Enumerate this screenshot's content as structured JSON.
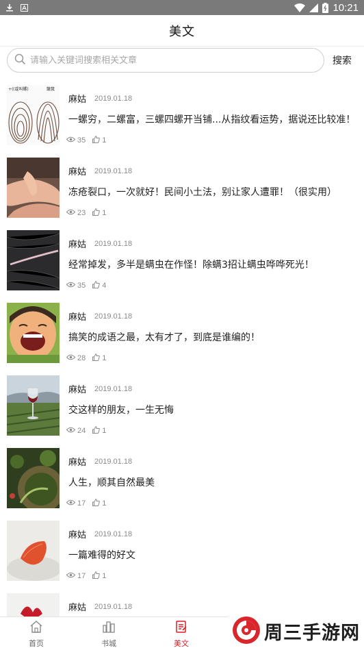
{
  "status_bar": {
    "time": "10:21",
    "battery": "battery-icon",
    "signal": "signal-icon",
    "wifi": "wifi-icon"
  },
  "header": {
    "title": "美文"
  },
  "search": {
    "placeholder": "请输入关键词搜索相关文章",
    "button_label": "搜索"
  },
  "articles": [
    {
      "author": "麻姑",
      "date": "2019.01.18",
      "title": "一螺穷，二螺富，三螺四螺开当铺...从指纹看运势，据说还比较准！",
      "views": "35",
      "likes": "1",
      "image": "fingerprint-thumbnail",
      "thumb_text_1": "(或叫螺)",
      "thumb_text_2": "簸箕"
    },
    {
      "author": "麻姑",
      "date": "2019.01.18",
      "title": "冻疮裂口，一次就好！民间小土法，别让家人遭罪！（很实用）",
      "views": "23",
      "likes": "1",
      "image": "hands-thumbnail"
    },
    {
      "author": "麻姑",
      "date": "2019.01.18",
      "title": "经常掉发，多半是螨虫在作怪！除螨3招让螨虫哗哗死光！",
      "views": "35",
      "likes": "4",
      "image": "hair-thumbnail"
    },
    {
      "author": "麻姑",
      "date": "2019.01.18",
      "title": "搞笑的成语之最，太有才了，到底是谁编的！",
      "views": "28",
      "likes": "1",
      "image": "laughing-child-thumbnail"
    },
    {
      "author": "麻姑",
      "date": "2019.01.18",
      "title": "交这样的朋友，一生无悔",
      "views": "24",
      "likes": "1",
      "image": "wine-glass-thumbnail"
    },
    {
      "author": "麻姑",
      "date": "2019.01.18",
      "title": "人生，顺其自然最美",
      "views": "17",
      "likes": "1",
      "image": "nature-thumbnail"
    },
    {
      "author": "麻姑",
      "date": "2019.01.18",
      "title": "一篇难得的好文",
      "views": "17",
      "likes": "1",
      "image": "flower-petal-thumbnail"
    },
    {
      "author": "麻姑",
      "date": "2019.01.18",
      "title": "",
      "views": "",
      "likes": "",
      "image": "red-flower-thumbnail"
    }
  ],
  "bottom_nav": [
    {
      "label": "首页",
      "icon": "home-icon",
      "active": false
    },
    {
      "label": "书城",
      "icon": "bookstore-icon",
      "active": false
    },
    {
      "label": "美文",
      "icon": "article-icon",
      "active": true
    }
  ],
  "watermark": {
    "text": "周三手游网",
    "logo": "swirl-logo"
  },
  "colors": {
    "accent": "#d81e27",
    "status_bar": "#7a7a7a",
    "muted_text": "#8a8a8a"
  }
}
